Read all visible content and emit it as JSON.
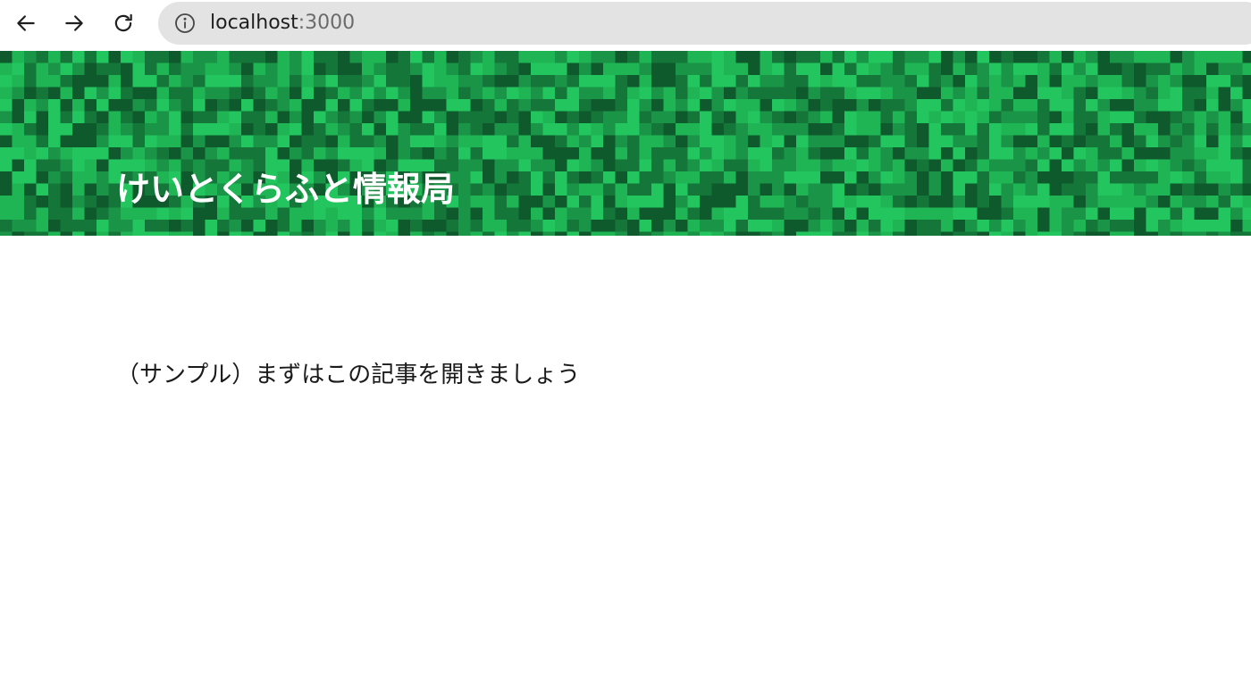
{
  "browser": {
    "url_host": "localhost",
    "url_port": ":3000"
  },
  "site": {
    "title": "けいとくらふと情報局",
    "banner_colors": [
      "#0f5a2c",
      "#15763a",
      "#1a9446",
      "#1fb554",
      "#22c55e"
    ]
  },
  "main": {
    "article_link": "（サンプル）まずはこの記事を開きましょう"
  }
}
